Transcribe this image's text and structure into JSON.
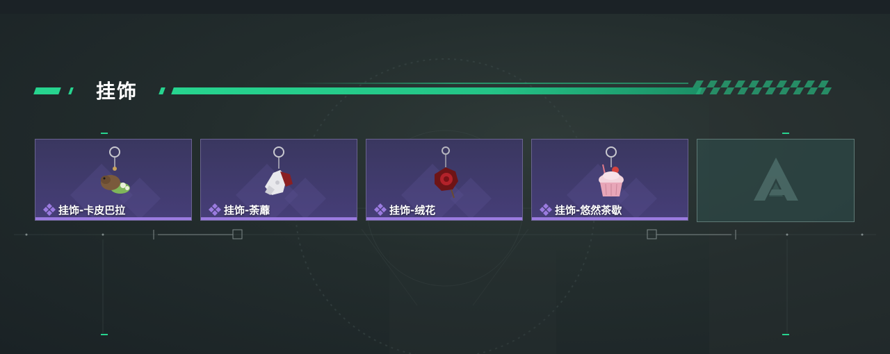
{
  "section": {
    "title": "挂饰"
  },
  "items": [
    {
      "label": "挂饰-卡皮巴拉",
      "icon": "capybara-charm-icon"
    },
    {
      "label": "挂饰-荼蘼",
      "icon": "white-flower-charm-icon"
    },
    {
      "label": "挂饰-绒花",
      "icon": "red-rose-charm-icon"
    },
    {
      "label": "挂饰-悠然茶歇",
      "icon": "cupcake-charm-icon"
    }
  ],
  "empty_slot": {
    "icon": "faction-logo-icon"
  },
  "colors": {
    "accent": "#27d48f",
    "card_bg": "#403a6c",
    "rarity": "#9b7be0"
  }
}
